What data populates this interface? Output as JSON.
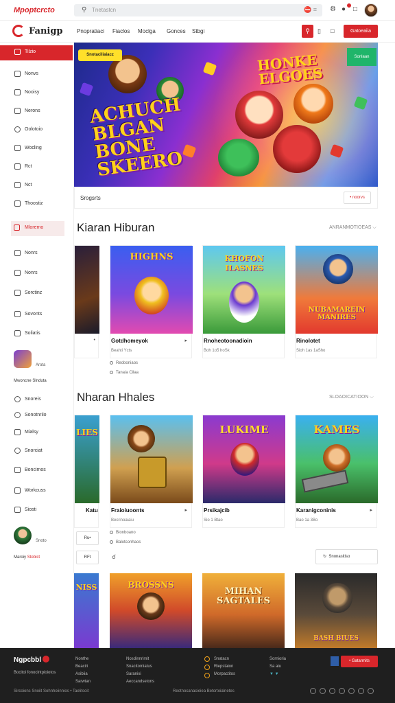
{
  "topbar": {
    "brand": "Mpoptcrcto",
    "search_placeholder": "Tnetastcn",
    "search_icon": "search-icon",
    "search_right": "⛔ ≡",
    "icons": [
      "gift-icon",
      "bell-icon",
      "chat-icon"
    ]
  },
  "navbar": {
    "logo": "Fanigp",
    "links": [
      "Pnopratiaci",
      "Fiaclos",
      "Moclga",
      "Gonces",
      "Stbgi"
    ],
    "cta": "Gatoeaiia"
  },
  "sidebar": {
    "items": [
      "Tilzio",
      "Nonvs",
      "Nooisy",
      "Nerons",
      "Oolotoio",
      "Wocling",
      "Rct",
      "Nct",
      "Thoostiz"
    ],
    "highlight": "Mloremo",
    "items2": [
      "Nonrs",
      "Nonrs",
      "Sorctinz",
      "Sovonts",
      "Soliatis"
    ],
    "user1_small": "Arota",
    "heading1": "Mwoncne Slnduta",
    "items3": [
      "Snoreis",
      "Sonotnriio",
      "Mialsy",
      "Snorciat",
      "Boncimos",
      "Workcuss",
      "Siosti"
    ],
    "user2_small": "Snoto",
    "heading2_a": "Maroiy",
    "heading2_b": "Stoblct"
  },
  "hero": {
    "badge": "Snotaciliaiacz",
    "title_left": "ACHUCH BLGAN BONE SKEERO",
    "title_right": "HONKE ELGOES",
    "corner_tag": "Sonlaan",
    "caption": "Srogsrts",
    "caption_button": "• noorvs"
  },
  "section1": {
    "title": "Kiaran Hiburan",
    "more": "ANRANMOTIOEAS ⌵",
    "cards": [
      {
        "name": "•",
        "meta": ""
      },
      {
        "name": "Gotdhomeyok",
        "meta": "Beahti Ycts",
        "art": "HIGHNS"
      },
      {
        "name": "Rnoheotoonadioin",
        "meta": "Boh 1o5 hoSk",
        "art": "KHOFON ILASNES"
      },
      {
        "name": "Rinolotet",
        "meta": "Sioh 1as 1aSho",
        "art": "NUBAMAREIN MANIRES"
      }
    ],
    "meta_lines": [
      "Reoboniaos",
      "Tanaia Cilaa"
    ]
  },
  "section2": {
    "title": "Nharan Hhales",
    "more": "SLOAOICATIOON ⌵",
    "cards": [
      {
        "name": "Katu",
        "meta": "",
        "art": "LIES"
      },
      {
        "name": "Fraioiuoonts",
        "meta": "Becrinoaiaiu",
        "art": ""
      },
      {
        "name": "Prsikajcib",
        "meta": "Sio 1 Btao",
        "art": "LUKIME"
      },
      {
        "name": "Karanigconinis",
        "meta": "Bao 1a 3Bo",
        "art": "KAMES"
      }
    ],
    "meta_lines": [
      "Bionboano",
      "Balotconhaos"
    ],
    "small_btns": [
      "Ru•",
      "RFt"
    ],
    "wide_btn": "Snonasitiso"
  },
  "section3": {
    "cards": [
      {
        "art": "NISS"
      },
      {
        "art": "BROSSNS"
      },
      {
        "art": "MIHAN SAGTALES"
      },
      {
        "art": "BASH BIUES"
      }
    ]
  },
  "footer": {
    "brand": "Ngpcbbl",
    "tagline": "Bocitoi fonocintpioiotos",
    "col1": [
      "Nonthe",
      "Beaciri",
      "Asibiia",
      "Sarwtan"
    ],
    "col2": [
      "Nosdinnrimit",
      "Snacitomiatus",
      "Saranixi",
      "Aeccandsetons"
    ],
    "col3": [
      "Snatacn",
      "Riepstaion",
      "Morpactitos"
    ],
    "col4": [
      "Sornioria",
      "Sa aiu",
      "▼ ▼"
    ],
    "cta": "• Gatarmits",
    "bottom_left": "Sircoions Snoiit Sohnhoiinnios • Taelitsoit",
    "bottom_right": "Reotnocanacieiea Betortoialnetes"
  },
  "colors": {
    "accent": "#d8262b",
    "footer_bg": "#1f1f1f",
    "green_tag": "#1fb56a"
  }
}
